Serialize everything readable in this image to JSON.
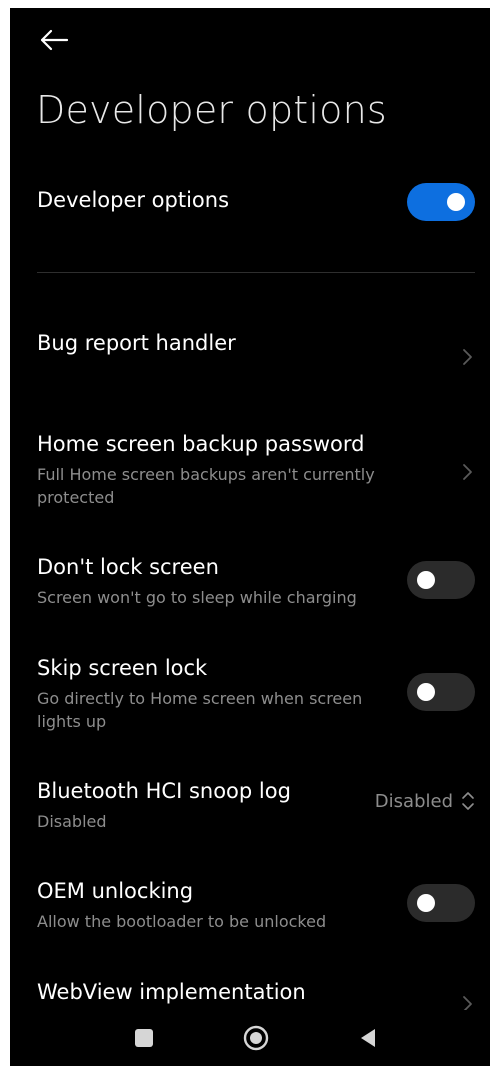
{
  "header": {
    "back_icon": "arrow-left-icon",
    "title": "Developer options"
  },
  "master_toggle": {
    "label": "Developer options",
    "enabled": true
  },
  "settings": [
    {
      "title": "Bug report handler",
      "subtitle": "",
      "control": "chevron"
    },
    {
      "title": "Home screen backup password",
      "subtitle": "Full Home screen backups aren't currently protected",
      "control": "chevron"
    },
    {
      "title": "Don't lock screen",
      "subtitle": "Screen won't go to sleep while charging",
      "control": "toggle",
      "enabled": false
    },
    {
      "title": "Skip screen lock",
      "subtitle": "Go directly to Home screen when screen lights up",
      "control": "toggle",
      "enabled": false
    },
    {
      "title": "Bluetooth HCI snoop log",
      "subtitle": "Disabled",
      "control": "dropdown",
      "value": "Disabled"
    },
    {
      "title": "OEM unlocking",
      "subtitle": "Allow the bootloader to be unlocked",
      "control": "toggle",
      "enabled": false
    },
    {
      "title": "WebView implementation",
      "subtitle": "",
      "control": "chevron"
    }
  ],
  "navbar": {
    "buttons": [
      "recents-square-icon",
      "home-circle-icon",
      "back-triangle-icon"
    ]
  },
  "colors": {
    "background": "#000000",
    "toggle_on": "#0d6fe0",
    "toggle_off": "#2b2b2b",
    "secondary_text": "#8d8d8d"
  }
}
